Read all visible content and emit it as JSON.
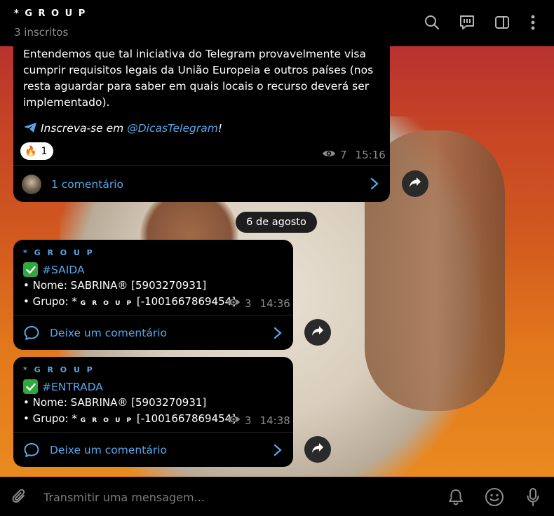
{
  "header": {
    "title": "* G R O U P",
    "subtitle": "3 inscritos",
    "icons": [
      "search-icon",
      "chat-icon",
      "sidebar-icon",
      "more-icon"
    ]
  },
  "first_post": {
    "text": "Entendemos que tal iniciativa do Telegram provavelmente visa cumprir requisitos legais da União Europeia e outros países (nos resta aguardar para saber em quais locais o recurso deverá ser implementado).",
    "promo_prefix": "Inscreva-se em ",
    "promo_link": "@DicasTelegram",
    "promo_suffix": "!",
    "reaction_emoji": "🔥",
    "reaction_count": "1",
    "views": "7",
    "time": "15:16",
    "comment_label": "1 comentário"
  },
  "date_separator": "6 de agosto",
  "messages": [
    {
      "sender": "* G R O U P",
      "tag": "#SAIDA",
      "line1": "• Nome: SABRINA®  [5903270931]",
      "line2_prefix": "• Grupo: * ",
      "line2_group": "G R O U P",
      "line2_suffix": " [-1001667869454]",
      "views": "3",
      "time": "14:36",
      "comment_label": "Deixe um comentário"
    },
    {
      "sender": "* G R O U P",
      "tag": "#ENTRADA",
      "line1": "• Nome: SABRINA®  [5903270931]",
      "line2_prefix": "• Grupo: * ",
      "line2_group": "G R O U P",
      "line2_suffix": " [-1001667869454]",
      "views": "3",
      "time": "14:38",
      "comment_label": "Deixe um comentário"
    }
  ],
  "composer": {
    "placeholder": "Transmitir uma mensagem...",
    "icons": [
      "attach-icon",
      "bell-icon",
      "emoji-icon",
      "mic-icon"
    ]
  },
  "colors": {
    "accent": "#5aa7e8",
    "muted": "#8b8b8b",
    "bubble": "#000000"
  }
}
